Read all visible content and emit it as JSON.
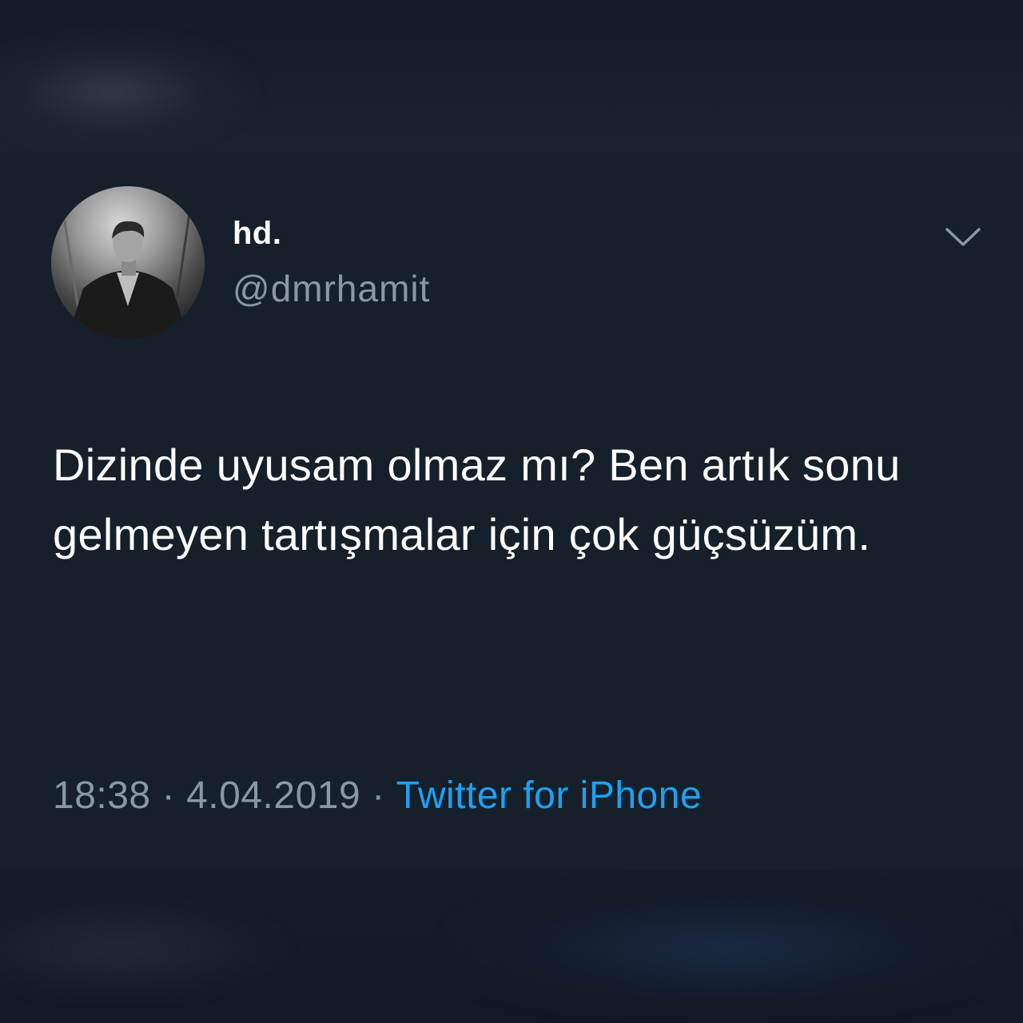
{
  "tweet": {
    "author": {
      "display_name": "hd.",
      "handle": "@dmrhamit",
      "avatar_icon": "profile-photo-avatar"
    },
    "menu_icon": "chevron-down-icon",
    "text": "Dizinde uyusam olmaz mı? Ben artık sonu gelmeyen tartışmalar için çok güçsüzüm.",
    "time": "18:38",
    "separator": "·",
    "date": "4.04.2019",
    "source": "Twitter for iPhone"
  },
  "colors": {
    "background": "#15202b",
    "primary_text": "#ffffff",
    "secondary_text": "#8899a6",
    "link": "#1da1f2"
  }
}
